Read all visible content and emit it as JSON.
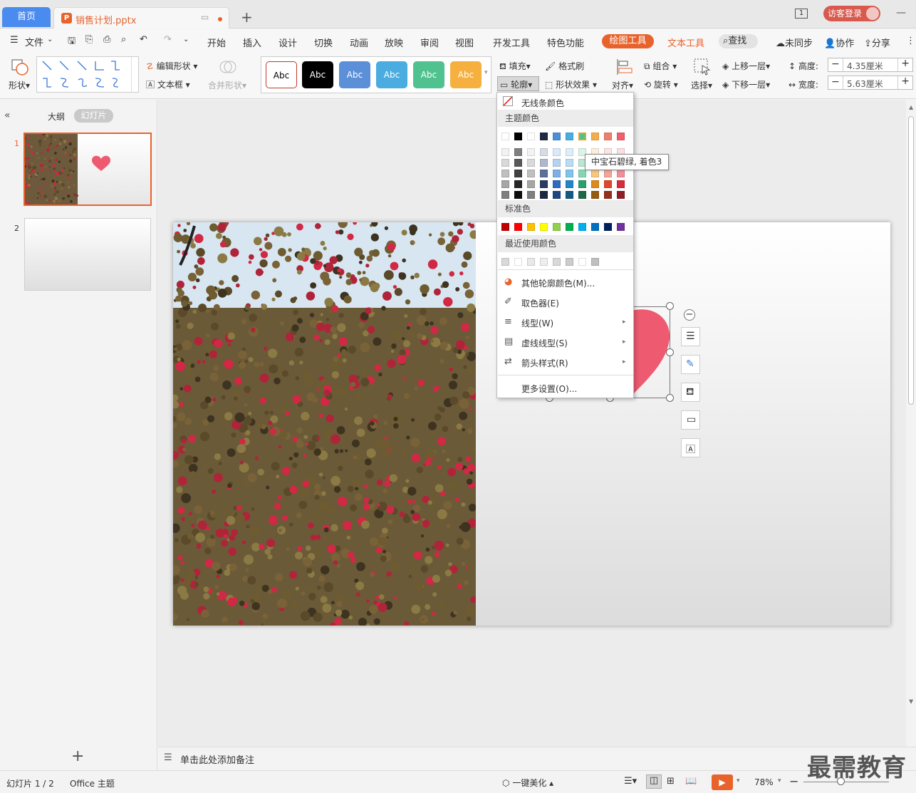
{
  "titlebar": {
    "home_tab": "首页",
    "file_tab": "销售计划.pptx",
    "file_icon": "P",
    "badge": "1",
    "login": "访客登录"
  },
  "menubar": {
    "file": "文件",
    "items": [
      "开始",
      "插入",
      "设计",
      "切换",
      "动画",
      "放映",
      "审阅",
      "视图",
      "开发工具",
      "特色功能"
    ],
    "drawing_tools": "绘图工具",
    "text_tools": "文本工具",
    "search": "查找",
    "sync": "未同步",
    "collab": "协作",
    "share": "分享"
  },
  "ribbon": {
    "shape": "形状",
    "edit_shape": "编辑形状",
    "textbox": "文本框",
    "merge_shape": "合并形状",
    "style_sample": "Abc",
    "style_colors": [
      "#ffffff",
      "#000000",
      "#5b8fd8",
      "#4aace0",
      "#4fc28f",
      "#f5b040"
    ],
    "fill": "填充",
    "format_painter": "格式刷",
    "outline": "轮廓",
    "shape_effect": "形状效果",
    "align": "对齐",
    "group": "组合",
    "rotate": "旋转",
    "select": "选择",
    "bring_forward": "上移一层",
    "send_backward": "下移一层",
    "height_label": "高度:",
    "height_value": "4.35厘米",
    "width_label": "宽度:",
    "width_value": "5.63厘米"
  },
  "leftpanel": {
    "outline_tab": "大纲",
    "slides_tab": "幻灯片",
    "slide_numbers": [
      "1",
      "2"
    ],
    "add": "+"
  },
  "dropdown": {
    "no_line": "无线条颜色",
    "theme_colors": "主题颜色",
    "standard_colors": "标准色",
    "recent_colors": "最近使用颜色",
    "more_colors": "其他轮廓颜色(M)...",
    "eyedropper": "取色器(E)",
    "line_type": "线型(W)",
    "dash_type": "虚线线型(S)",
    "arrow_style": "箭头样式(R)",
    "more_settings": "更多设置(O)...",
    "theme_row": [
      "#ffffff",
      "#000000",
      "#ffffff",
      "#1f2a44",
      "#4a90d9",
      "#4aace0",
      "#4fc28f",
      "#f5ad4a",
      "#ee7f6b",
      "#ef5f6e"
    ],
    "theme_shades": [
      [
        "#f2f2f2",
        "#7f7f7f",
        "#f2f2f2",
        "#d6dbe6",
        "#dbe8f7",
        "#dbeef9",
        "#dcf3e8",
        "#fdefdb",
        "#fce5e1",
        "#fcdfe2"
      ],
      [
        "#d9d9d9",
        "#595959",
        "#d9d9d9",
        "#aeb7cd",
        "#b7d2ef",
        "#b7dcf3",
        "#b9e7d2",
        "#fbdfb7",
        "#f8cbc3",
        "#f9bfc5"
      ],
      [
        "#bfbfbf",
        "#404040",
        "#bfbfbf",
        "#5d6f9b",
        "#7fb0e5",
        "#7fc4eb",
        "#84d6b1",
        "#f8c77f",
        "#f4a596",
        "#f48f9a"
      ],
      [
        "#a6a6a6",
        "#262626",
        "#a6a6a6",
        "#2c3b63",
        "#2d6ac0",
        "#1f87c5",
        "#2c9f6a",
        "#dc8a18",
        "#e0482d",
        "#d92b3e"
      ],
      [
        "#7f7f7f",
        "#0d0d0d",
        "#7f7f7f",
        "#1c2741",
        "#1e4780",
        "#155a83",
        "#1d6a47",
        "#935c10",
        "#952f1e",
        "#911d29"
      ]
    ],
    "standard_row": [
      "#c00000",
      "#ff0000",
      "#ffc000",
      "#ffff00",
      "#92d050",
      "#00b050",
      "#00b0f0",
      "#0070c0",
      "#002060",
      "#7030a0"
    ],
    "recent_row": [
      "#d9d9d9",
      "#ffffff",
      "#e8e8e8",
      "#eeeeee",
      "#d9d9d9",
      "#cccccc",
      "#ffffff",
      "#bfbfbf"
    ],
    "tooltip": "中宝石碧绿, 着色3"
  },
  "notes": {
    "placeholder": "单击此处添加备注"
  },
  "status": {
    "slide_counter": "幻灯片 1 / 2",
    "theme": "Office 主题",
    "beautify": "一键美化",
    "zoom": "78%"
  },
  "watermark": "最需教育",
  "colors": {
    "accent": "#e8632c",
    "home_tab": "#4a8bf0",
    "heart": "#ee5a6f"
  }
}
